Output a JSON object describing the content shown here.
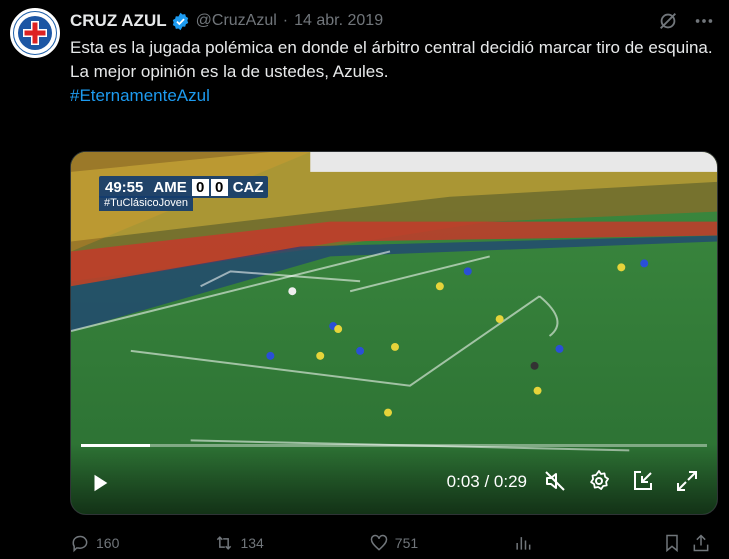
{
  "tweet": {
    "author_name": "CRUZ AZUL",
    "handle": "@CruzAzul",
    "separator": "·",
    "date": "14 abr. 2019",
    "text_line1": "Esta es la jugada polémica en donde el árbitro central decidió marcar tiro de esquina.",
    "text_line2": "La mejor opinión es la de ustedes, Azules.",
    "hashtag": "#EternamenteAzul"
  },
  "video": {
    "scorebug": {
      "clock": "49:55",
      "home": "AME",
      "home_score": "0",
      "away_score": "0",
      "away": "CAZ",
      "hashtag": "#TuClásicoJoven"
    },
    "time_display": "0:03 / 0:29",
    "progress": 0.11,
    "icons": {
      "play": "play-icon",
      "mute": "muted-speaker-icon",
      "settings": "gear-icon",
      "docking": "dock-icon",
      "fullscreen": "expand-icon"
    }
  },
  "actions": {
    "replies": "160",
    "reposts": "134",
    "likes": "751"
  },
  "colors": {
    "background": "#000000",
    "text": "#e7e9ea",
    "secondary": "#71767b",
    "link": "#1d9bf0",
    "field": "#2f7a3a"
  }
}
